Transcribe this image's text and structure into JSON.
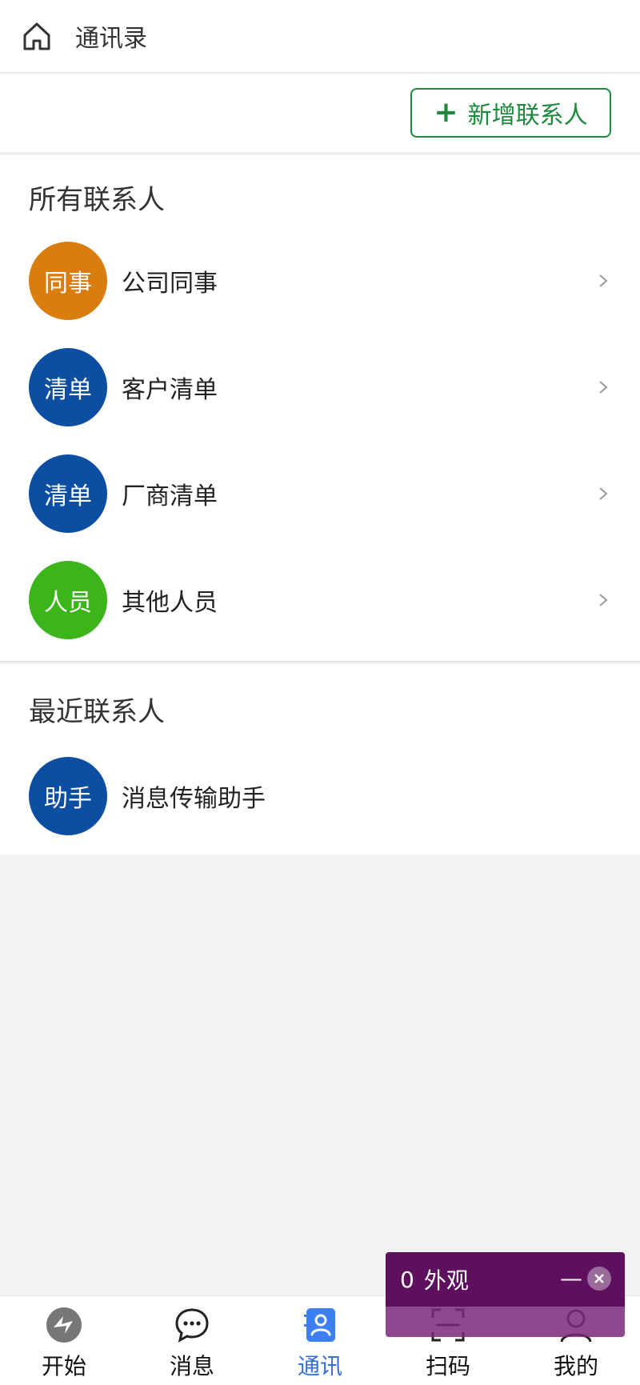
{
  "header": {
    "title": "通讯录",
    "home_icon": "home-icon"
  },
  "toolbar": {
    "add_contact_label": "新增联系人",
    "add_icon": "plus-icon",
    "accent_color": "#1e8a3c"
  },
  "all_contacts": {
    "title": "所有联系人",
    "items": [
      {
        "avatar_text": "同事",
        "label": "公司同事",
        "color": "#d97d0f"
      },
      {
        "avatar_text": "清单",
        "label": "客户清单",
        "color": "#0b4ea2"
      },
      {
        "avatar_text": "清单",
        "label": "厂商清单",
        "color": "#0b4ea2"
      },
      {
        "avatar_text": "人员",
        "label": "其他人员",
        "color": "#3cb51b"
      }
    ]
  },
  "recent_contacts": {
    "title": "最近联系人",
    "items": [
      {
        "avatar_text": "助手",
        "label": "消息传输助手",
        "color": "#0b4ea2"
      }
    ]
  },
  "bottom_nav": {
    "items": [
      {
        "label": "开始",
        "icon": "start-logo-icon"
      },
      {
        "label": "消息",
        "icon": "chat-bubble-icon"
      },
      {
        "label": "通讯",
        "icon": "contacts-book-icon",
        "active": true
      },
      {
        "label": "扫码",
        "icon": "scan-icon"
      },
      {
        "label": "我的",
        "icon": "user-icon"
      }
    ],
    "active_color": "#2f6fe0"
  },
  "overlay": {
    "count": "0",
    "label": "外观",
    "minimize_symbol": "—",
    "background": "#5e0f5e"
  }
}
